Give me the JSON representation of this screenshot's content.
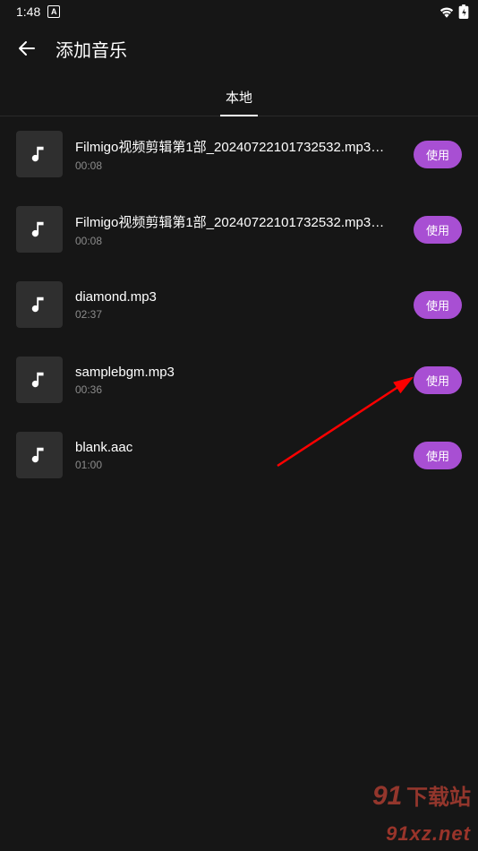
{
  "status": {
    "time": "1:48",
    "badge": "A"
  },
  "header": {
    "title": "添加音乐"
  },
  "tabs": {
    "local": "本地"
  },
  "button_label": "使用",
  "items": [
    {
      "title": "Filmigo视频剪辑第1部_20240722101732532.mp3…",
      "duration": "00:08"
    },
    {
      "title": "Filmigo视频剪辑第1部_20240722101732532.mp3…",
      "duration": "00:08"
    },
    {
      "title": "diamond.mp3",
      "duration": "02:37"
    },
    {
      "title": "samplebgm.mp3",
      "duration": "00:36"
    },
    {
      "title": "blank.aac",
      "duration": "01:00"
    }
  ],
  "watermark": {
    "sub": "91xz.net"
  }
}
